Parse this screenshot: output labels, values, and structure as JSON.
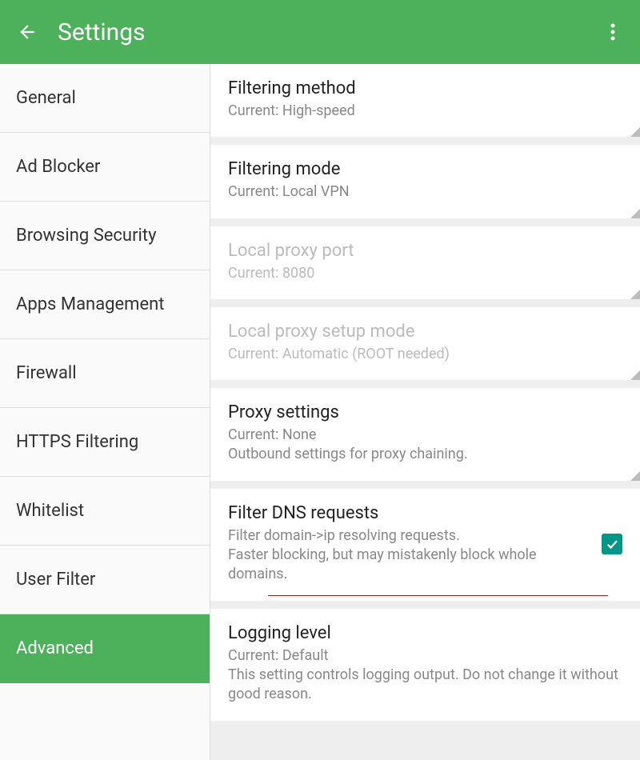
{
  "appbar": {
    "title": "Settings"
  },
  "sidebar": {
    "items": [
      {
        "label": "General"
      },
      {
        "label": "Ad Blocker"
      },
      {
        "label": "Browsing Security"
      },
      {
        "label": "Apps Management"
      },
      {
        "label": "Firewall"
      },
      {
        "label": "HTTPS Filtering"
      },
      {
        "label": "Whitelist"
      },
      {
        "label": "User Filter"
      },
      {
        "label": "Advanced"
      }
    ]
  },
  "settings": {
    "filtering_method": {
      "title": "Filtering method",
      "sub": "Current: High-speed"
    },
    "filtering_mode": {
      "title": "Filtering mode",
      "sub": "Current: Local VPN"
    },
    "local_proxy_port": {
      "title": "Local proxy port",
      "sub": "Current: 8080"
    },
    "local_proxy_setup_mode": {
      "title": "Local proxy setup mode",
      "sub": "Current: Automatic (ROOT needed)"
    },
    "proxy_settings": {
      "title": "Proxy settings",
      "sub1": "Current: None",
      "sub2": "Outbound settings for proxy chaining."
    },
    "filter_dns": {
      "title": "Filter DNS requests",
      "sub": "Filter domain->ip resolving requests.\nFaster blocking, but may mistakenly block whole domains.",
      "checked": true
    },
    "logging_level": {
      "title": "Logging level",
      "sub1": "Current: Default",
      "sub2": "This setting controls logging output. Do not change it without good reason."
    }
  }
}
